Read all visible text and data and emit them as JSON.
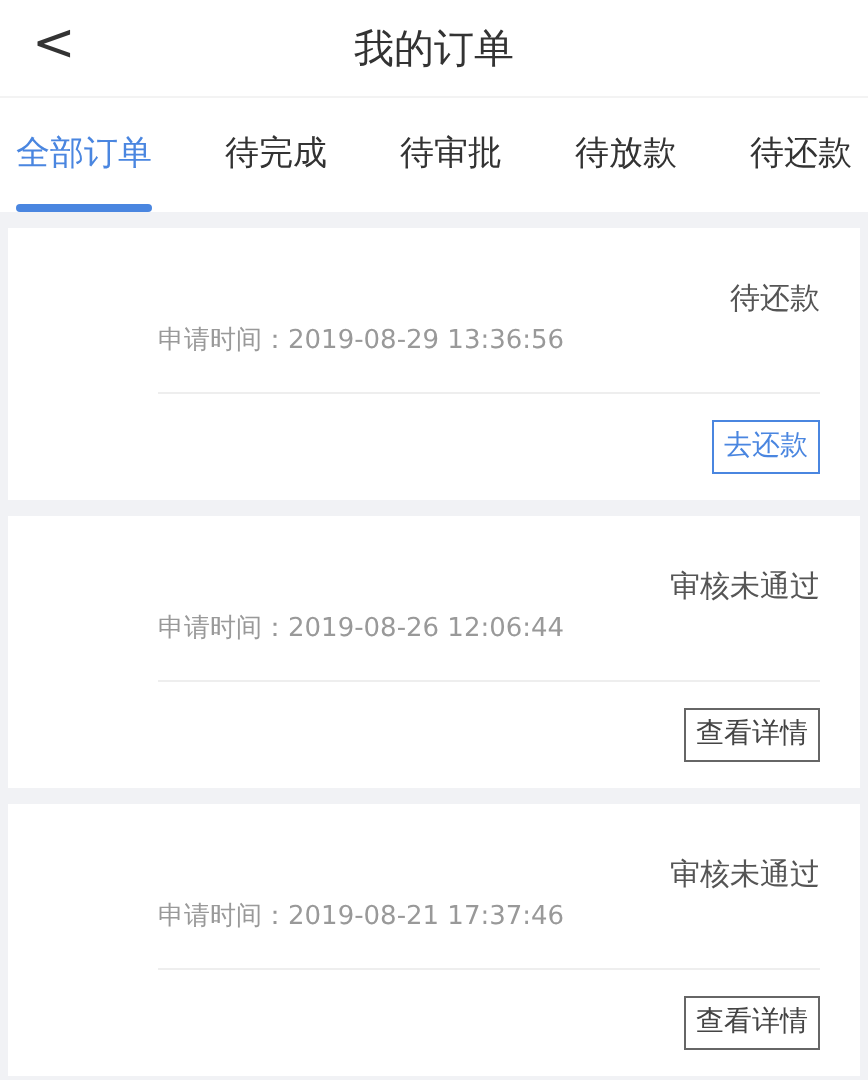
{
  "header": {
    "back": "<",
    "title": "我的订单"
  },
  "tabs": [
    {
      "label": "全部订单",
      "selected": true
    },
    {
      "label": "待完成",
      "selected": false
    },
    {
      "label": "待审批",
      "selected": false
    },
    {
      "label": "待放款",
      "selected": false
    },
    {
      "label": "待还款",
      "selected": false
    }
  ],
  "orders": [
    {
      "status": "待还款",
      "time": "申请时间：2019-08-29 13:36:56",
      "action": {
        "label": "去还款",
        "kind": "primary"
      }
    },
    {
      "status": "审核未通过",
      "time": "申请时间：2019-08-26 12:06:44",
      "action": {
        "label": "查看详情",
        "kind": "secondary"
      }
    },
    {
      "status": "审核未通过",
      "time": "申请时间：2019-08-21 17:37:46",
      "action": {
        "label": "查看详情",
        "kind": "secondary"
      }
    }
  ]
}
